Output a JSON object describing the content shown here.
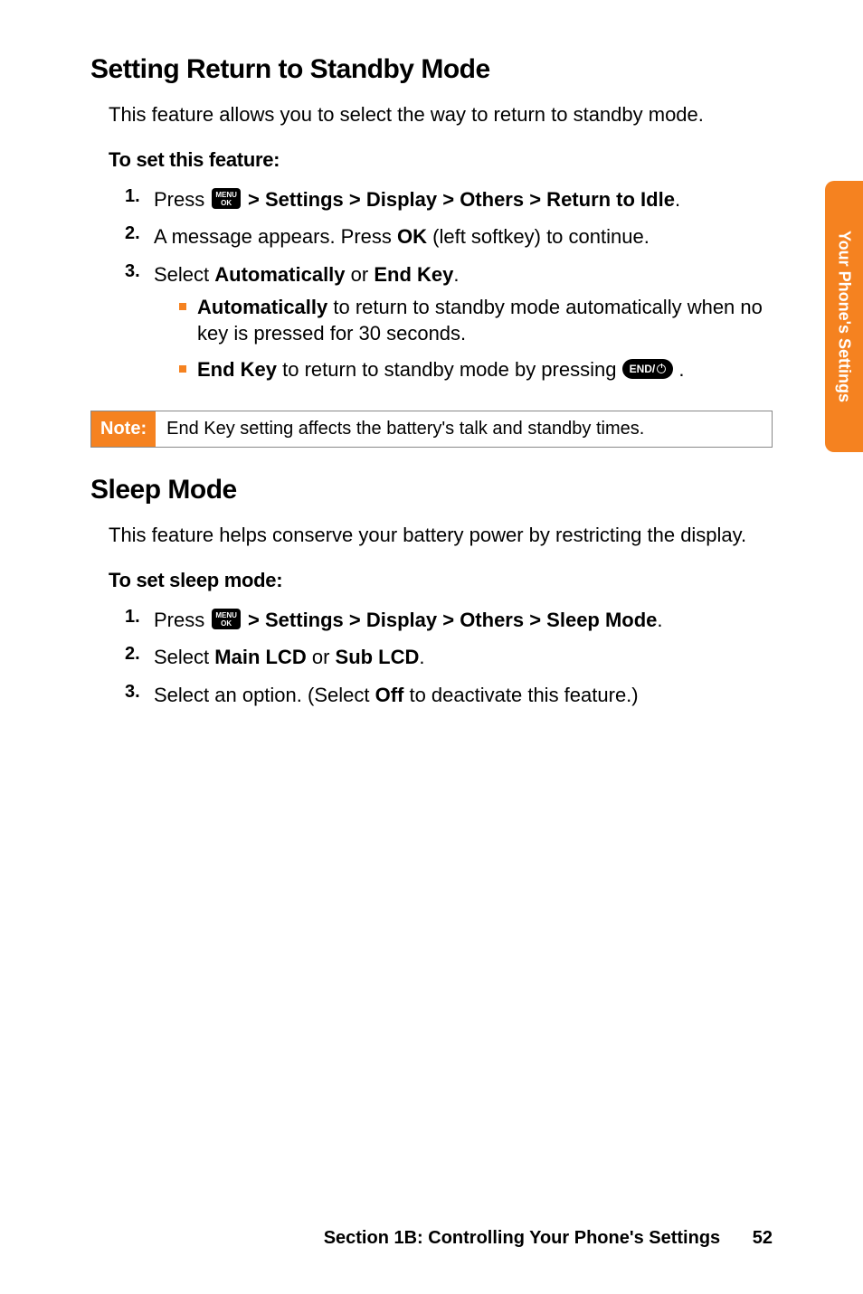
{
  "sidebar": {
    "label": "Your Phone's Settings"
  },
  "sec1": {
    "heading": "Setting Return to Standby Mode",
    "intro": "This feature allows you to select the way to return to standby mode.",
    "subhead": "To set this feature:",
    "steps": {
      "s1": {
        "num": "1.",
        "pre": "Press ",
        "path": " > Settings > Display > Others > Return to Idle",
        "end": "."
      },
      "s2": {
        "num": "2.",
        "t1": "A message appears. Press ",
        "ok": "OK",
        "t2": " (left softkey) to continue."
      },
      "s3": {
        "num": "3.",
        "t1": "Select ",
        "opt1": "Automatically",
        "or": " or ",
        "opt2": "End Key",
        "end": ".",
        "b1_label": "Automatically",
        "b1_rest": " to return to standby mode automatically when no key is pressed for 30 seconds.",
        "b2_label": "End Key",
        "b2_rest_a": " to return to standby mode by pressing ",
        "b2_rest_b": " ."
      }
    },
    "note": {
      "label": "Note:",
      "text": "End Key setting affects the battery's talk and standby times."
    }
  },
  "sec2": {
    "heading": "Sleep Mode",
    "intro": "This feature helps conserve your battery power by restricting the display.",
    "subhead": "To set sleep mode:",
    "steps": {
      "s1": {
        "num": "1.",
        "pre": "Press ",
        "path": " > Settings > Display > Others > Sleep Mode",
        "end": "."
      },
      "s2": {
        "num": "2.",
        "t1": "Select ",
        "opt1": "Main LCD",
        "or": " or ",
        "opt2": "Sub LCD",
        "end": "."
      },
      "s3": {
        "num": "3.",
        "t1": "Select an option. (Select ",
        "off": "Off",
        "t2": " to deactivate this feature.)"
      }
    }
  },
  "footer": {
    "section": "Section 1B: Controlling Your Phone's Settings",
    "page": "52"
  },
  "icons": {
    "menu_line1": "MENU",
    "menu_line2": "OK",
    "end": "END/"
  }
}
